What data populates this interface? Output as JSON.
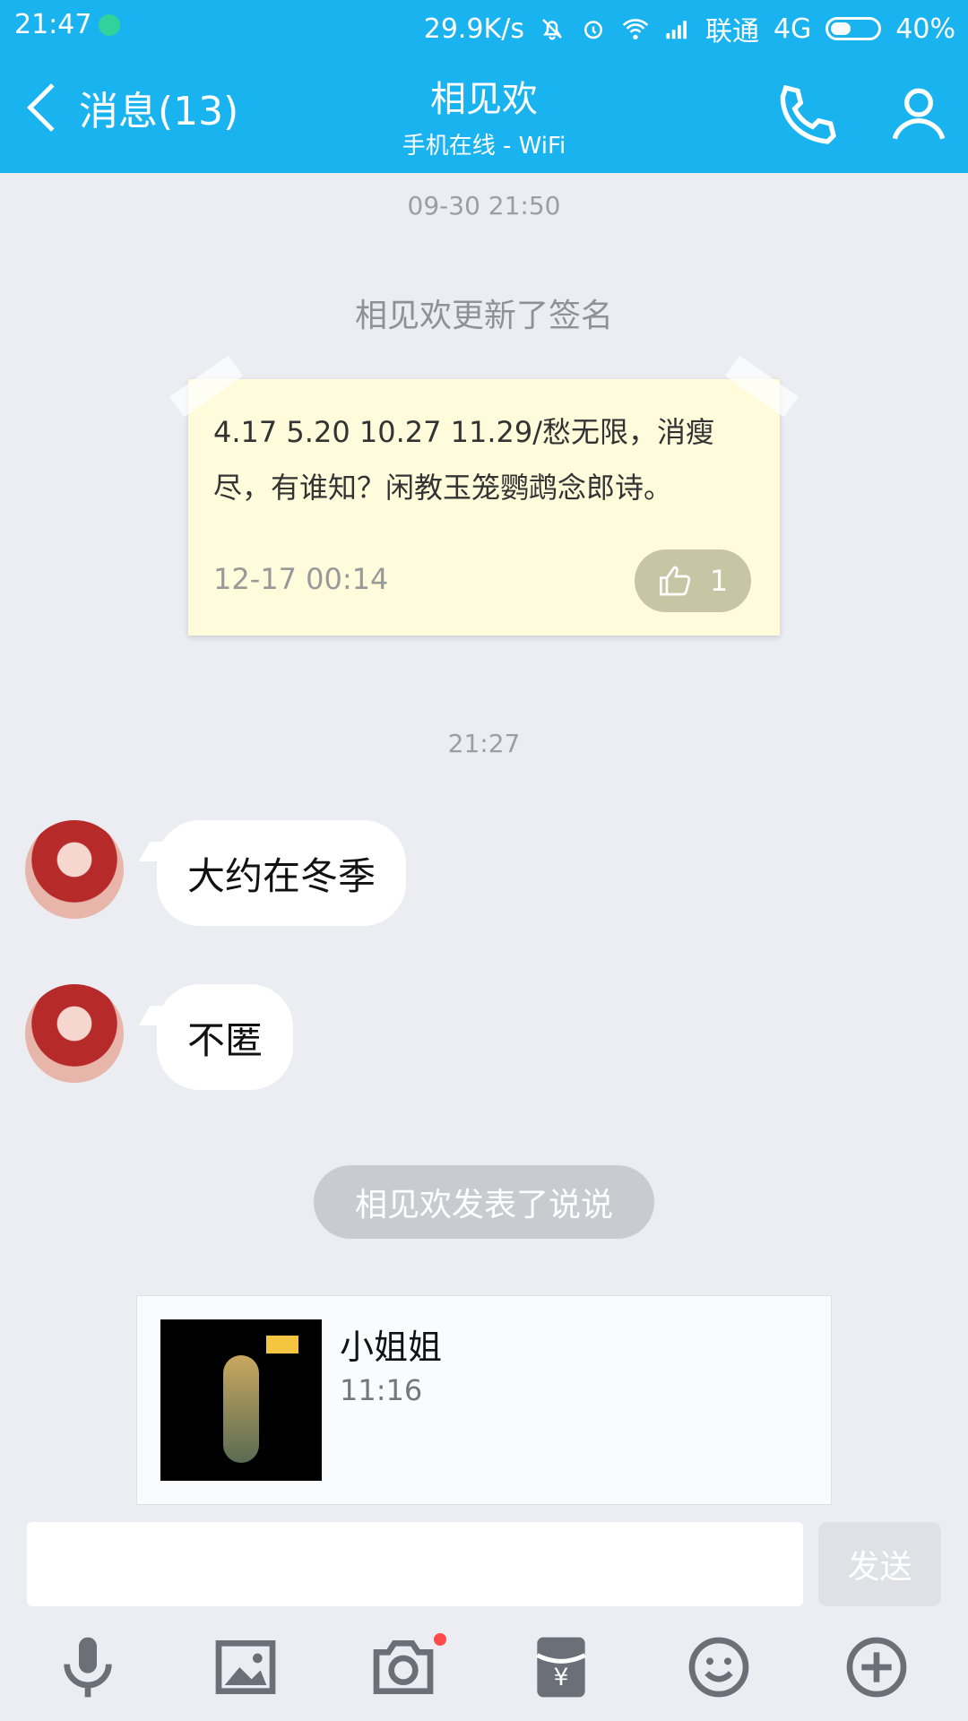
{
  "status_bar": {
    "time": "21:47",
    "speed": "29.9K/s",
    "carrier": "联通",
    "network": "4G",
    "battery": "40%"
  },
  "header": {
    "back_label": "消息(13)",
    "title": "相见欢",
    "subtitle": "手机在线 - WiFi"
  },
  "chat": {
    "timestamp1": "09-30 21:50",
    "signature_update": "相见欢更新了签名",
    "signature": {
      "text": "4.17 5.20 10.27 11.29/愁无限，消瘦尽，有谁知？闲教玉笼鹦鹉念郎诗。",
      "date": "12-17 00:14",
      "likes": "1"
    },
    "timestamp2": "21:27",
    "messages": [
      {
        "text": "大约在冬季"
      },
      {
        "text": "不匿"
      }
    ],
    "post_notice": "相见欢发表了说说",
    "post_card": {
      "title": "小姐姐",
      "time": "11:16"
    }
  },
  "input": {
    "placeholder": "",
    "send_label": "发送"
  },
  "toolbar": {
    "icons": [
      "microphone-icon",
      "image-icon",
      "camera-icon",
      "red-packet-icon",
      "emoji-icon",
      "plus-icon"
    ]
  },
  "colors": {
    "header_blue": "#19b3ef",
    "background": "#ebedf2"
  }
}
